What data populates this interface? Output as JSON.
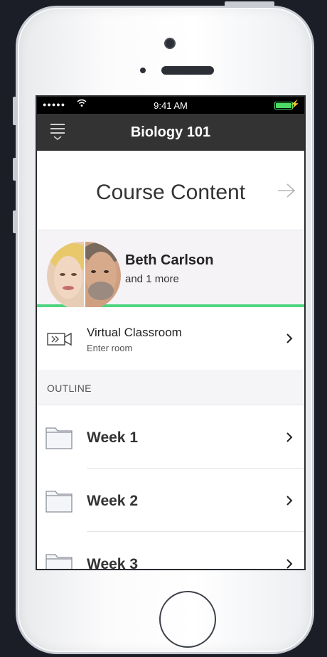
{
  "status_bar": {
    "signal": "●●●●●",
    "time": "9:41 AM"
  },
  "nav": {
    "title": "Biology 101",
    "menu_icon": "hamburger-menu-icon"
  },
  "course_content": {
    "title": "Course Content",
    "arrow_icon": "arrow-right-icon"
  },
  "participants": {
    "name": "Beth Carlson",
    "more": "and 1 more",
    "accent": "#4fd47f"
  },
  "virtual_classroom": {
    "title": "Virtual Classroom",
    "subtitle": "Enter room",
    "icon": "video-camera-icon"
  },
  "outline": {
    "label": "OUTLINE",
    "items": [
      {
        "label": "Week 1"
      },
      {
        "label": "Week 2"
      },
      {
        "label": "Week 3"
      }
    ]
  },
  "colors": {
    "nav_bg": "#333333",
    "progress_green": "#4fd47f",
    "battery": "#4cd964"
  }
}
